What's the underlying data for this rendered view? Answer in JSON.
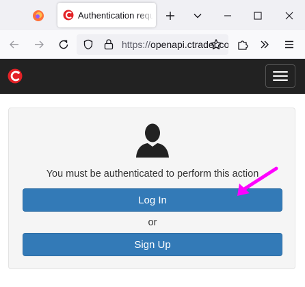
{
  "browser": {
    "tab_title": "Authentication required",
    "url_scheme": "https://",
    "url_host": "openapi.ctrader.com"
  },
  "page": {
    "message": "You must be authenticated to perform this action",
    "login_label": "Log In",
    "or_label": "or",
    "signup_label": "Sign Up"
  },
  "icons": {
    "firefox": "firefox-icon",
    "site_logo": "ctrader-logo-icon",
    "avatar": "user-silhouette-icon",
    "annotation": "magenta-arrow"
  },
  "colors": {
    "header_bg": "#222222",
    "button_bg": "#337ab7",
    "arrow": "#ff00ff"
  }
}
